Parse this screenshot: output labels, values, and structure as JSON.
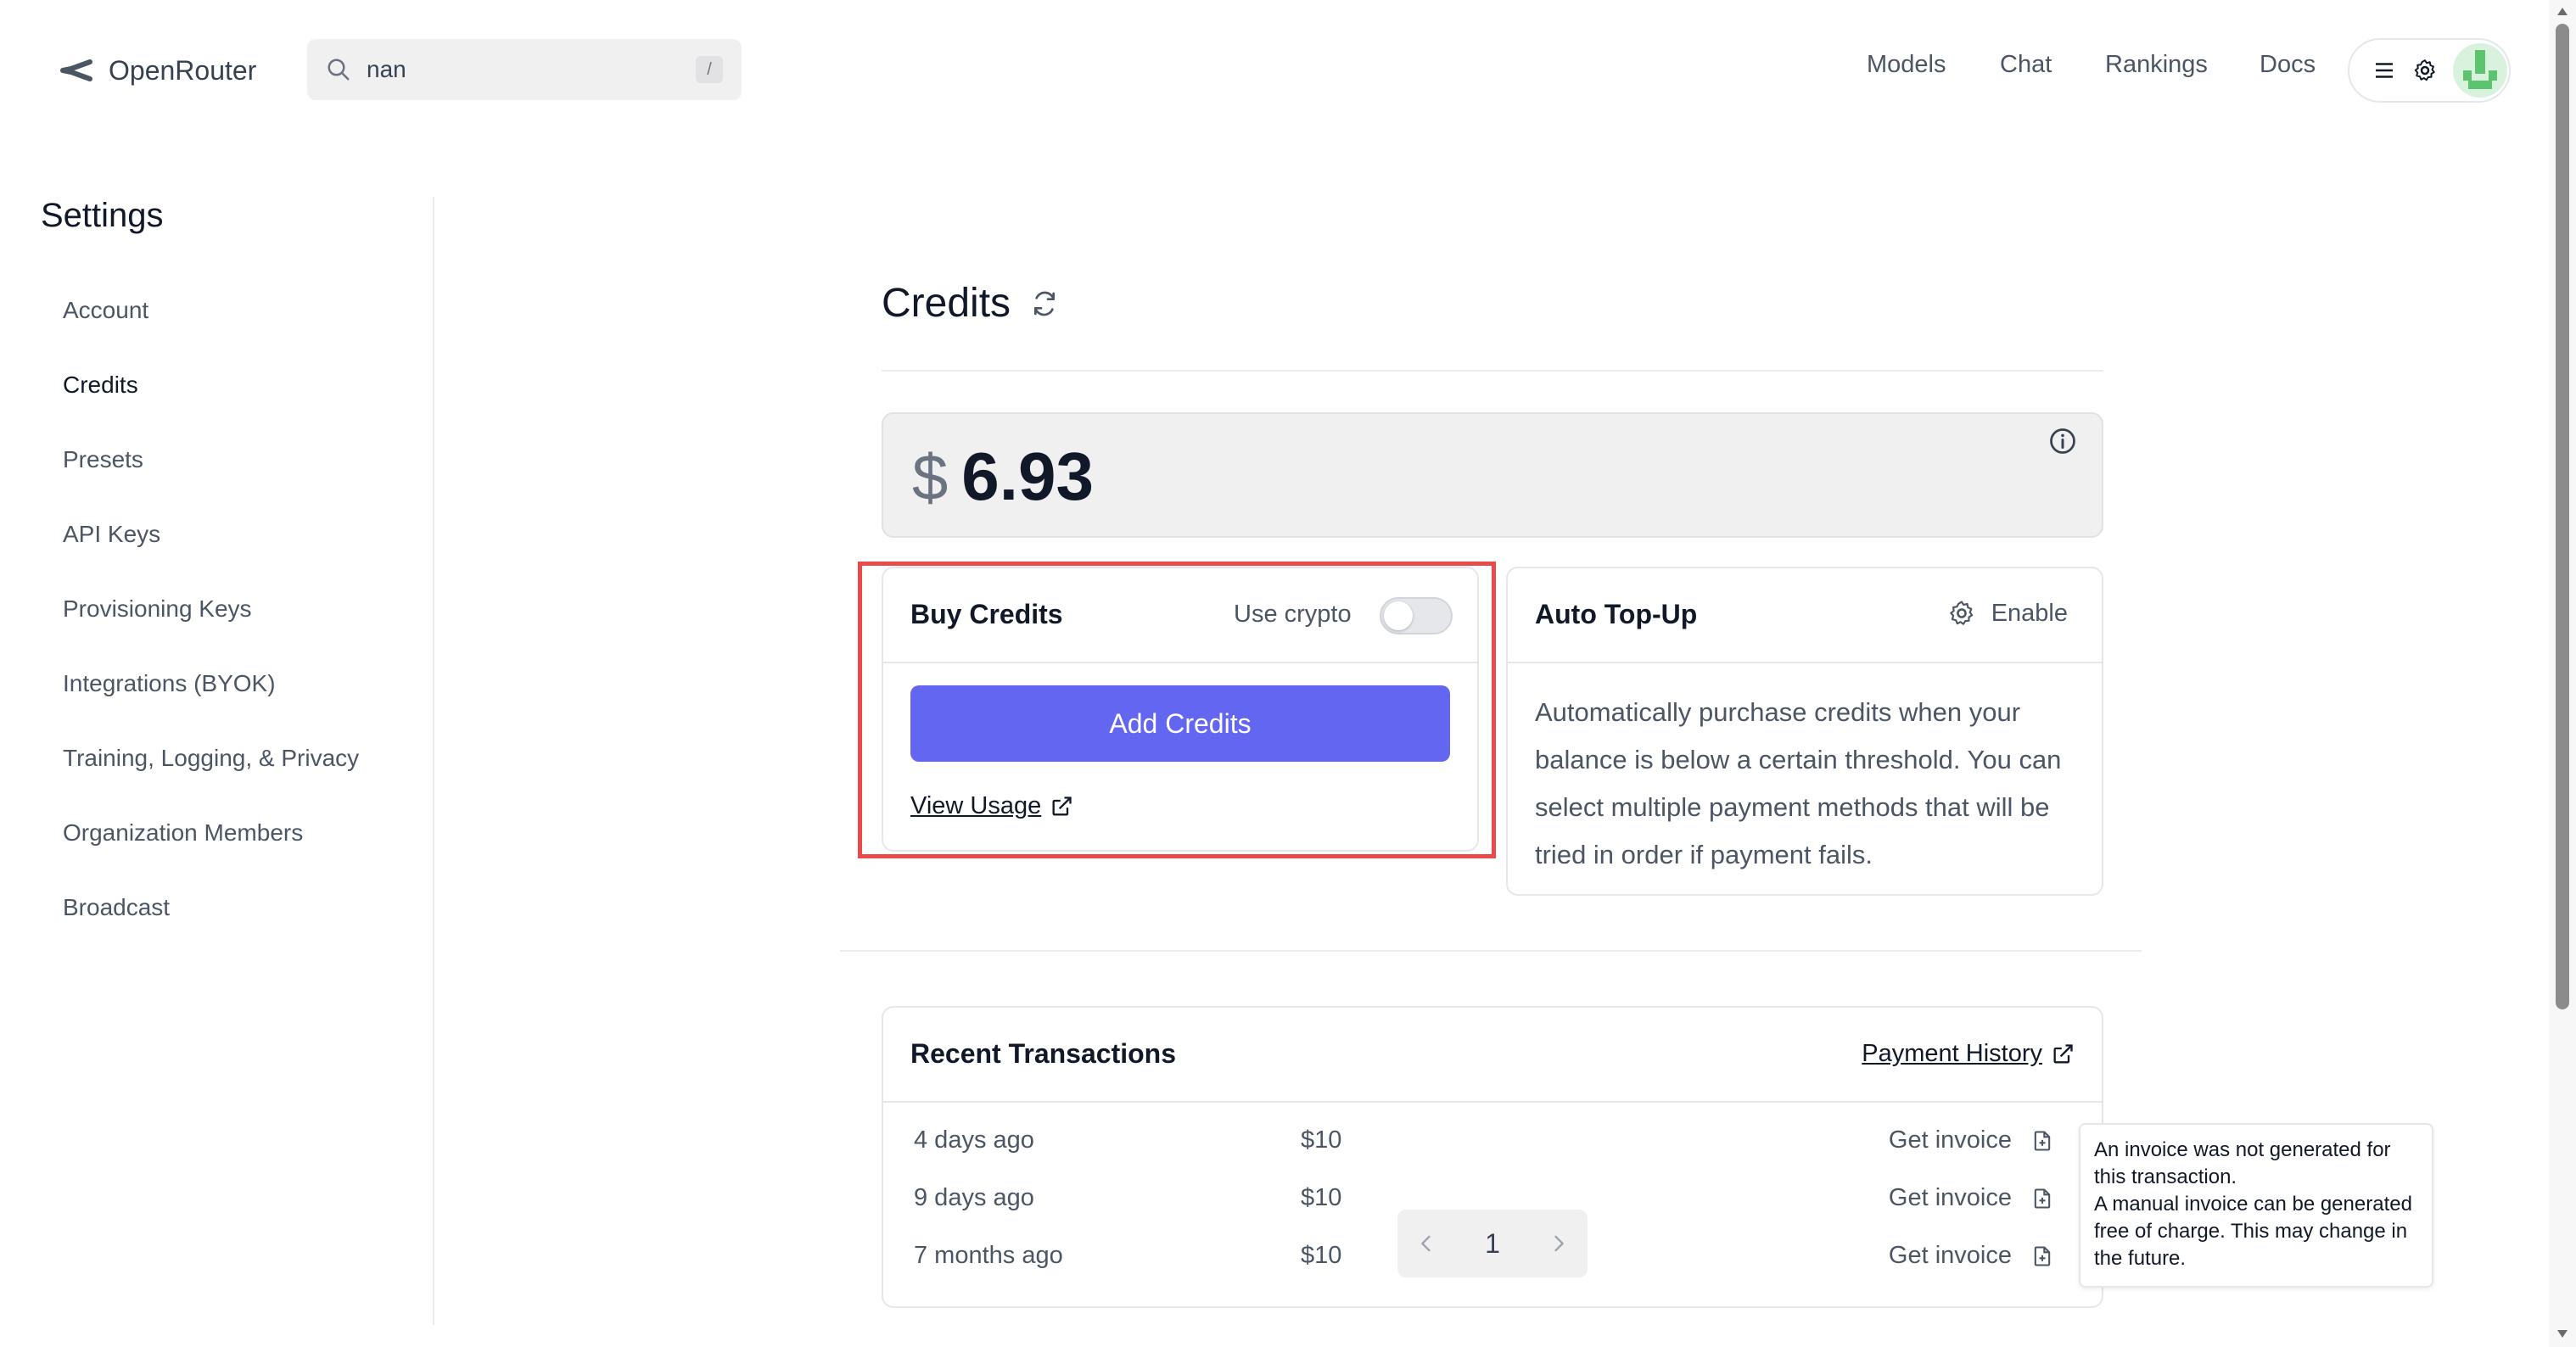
{
  "header": {
    "brand": "OpenRouter",
    "search": {
      "value": "nan",
      "shortcut": "/"
    },
    "nav": [
      "Models",
      "Chat",
      "Rankings",
      "Docs"
    ],
    "icons": [
      "menu-icon",
      "gear-icon",
      "avatar"
    ]
  },
  "sidebar": {
    "title": "Settings",
    "active": "Credits",
    "items": [
      {
        "label": "Account"
      },
      {
        "label": "Credits"
      },
      {
        "label": "Presets"
      },
      {
        "label": "API Keys"
      },
      {
        "label": "Provisioning Keys"
      },
      {
        "label": "Integrations (BYOK)"
      },
      {
        "label": "Training, Logging, & Privacy"
      },
      {
        "label": "Organization Members"
      },
      {
        "label": "Broadcast"
      }
    ]
  },
  "main": {
    "title": "Credits",
    "balance": {
      "currency": "$",
      "amount": "6.93"
    },
    "buy_credits": {
      "title": "Buy Credits",
      "crypto_label": "Use crypto",
      "crypto_enabled": false,
      "add_button": "Add Credits",
      "view_usage": "View Usage"
    },
    "auto_topup": {
      "title": "Auto Top-Up",
      "enable_label": "Enable",
      "description": "Automatically purchase credits when your balance is below a certain threshold. You can select multiple payment methods that will be tried in order if payment fails."
    },
    "transactions": {
      "title": "Recent Transactions",
      "history_link": "Payment History",
      "rows": [
        {
          "date": "4 days ago",
          "amount": "$10",
          "action": "Get invoice"
        },
        {
          "date": "9 days ago",
          "amount": "$10",
          "action": "Get invoice"
        },
        {
          "date": "7 months ago",
          "amount": "$10",
          "action": "Get invoice"
        }
      ],
      "page": "1"
    },
    "tooltip": {
      "line1": "An invoice was not generated for this transaction.",
      "line2": "A manual invoice can be generated free of charge. This may change in the future."
    }
  },
  "colors": {
    "accent": "#6366f1",
    "highlight": "#ea4a4a",
    "muted_text": "#4b5563"
  }
}
